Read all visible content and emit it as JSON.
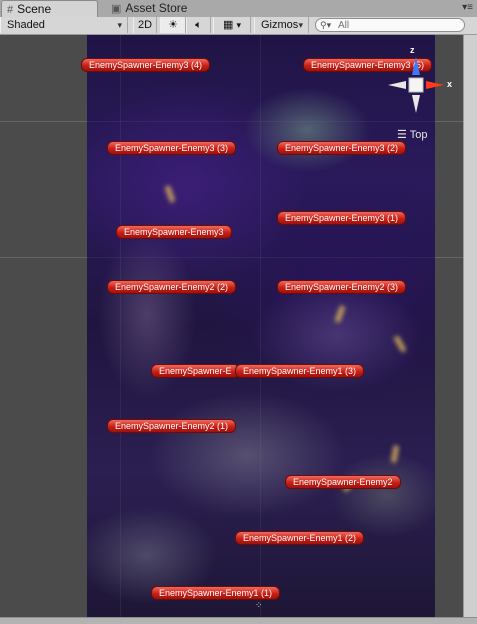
{
  "tabs": [
    {
      "label": "Scene",
      "icon": "grid-icon"
    },
    {
      "label": "Asset Store",
      "icon": "store-icon"
    }
  ],
  "toolbar": {
    "shading_mode": "Shaded",
    "mode_2d": "2D",
    "lighting_icon": "sun-icon",
    "audio_icon": "speaker-icon",
    "effects_icon": "image-icon",
    "gizmos_label": "Gizmos",
    "search_placeholder": "All"
  },
  "orientation_gizmo": {
    "axis_z": "z",
    "axis_x": "x",
    "view_label": "Top"
  },
  "spawners": [
    "EnemySpawner-Enemy3 (4)",
    "EnemySpawner-Enemy3 (5)",
    "EnemySpawner-Enemy3 (3)",
    "EnemySpawner-Enemy3 (2)",
    "EnemySpawner-Enemy3 (1)",
    "EnemySpawner-Enemy3",
    "EnemySpawner-Enemy2 (2)",
    "EnemySpawner-Enemy2 (3)",
    "EnemySpawner-E",
    "EnemySpawner-Enemy1 (3)",
    "EnemySpawner-Enemy2 (1)",
    "EnemySpawner-Enemy2",
    "EnemySpawner-Enemy1 (2)",
    "EnemySpawner-Enemy1 (1)",
    "EnemySpawner-E"
  ],
  "colors": {
    "spawner_label": "#d2261c",
    "gizmo_z": "#3a7bff",
    "gizmo_x": "#ff3a1a"
  }
}
